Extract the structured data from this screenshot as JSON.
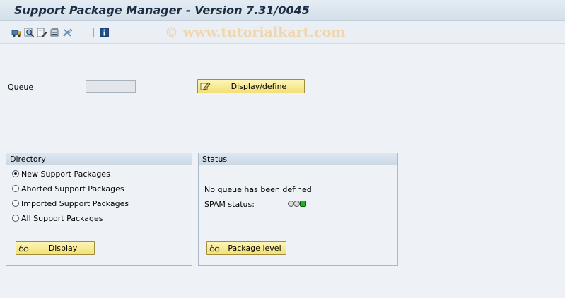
{
  "window": {
    "title": "Support Package Manager - Version 7.31/0045"
  },
  "watermark": "© www.tutorialkart.com",
  "toolbar": {
    "icons": [
      "truck-icon",
      "magnifier-icon",
      "edit-document-icon",
      "import-icon",
      "tools-icon",
      "info-icon"
    ]
  },
  "queue": {
    "label": "Queue",
    "value": "",
    "button_label": "Display/define"
  },
  "directory": {
    "title": "Directory",
    "options": [
      {
        "label": "New Support Packages",
        "selected": true
      },
      {
        "label": "Aborted Support Packages",
        "selected": false
      },
      {
        "label": "Imported Support Packages",
        "selected": false
      },
      {
        "label": "All Support Packages",
        "selected": false
      }
    ],
    "button_label": "Display"
  },
  "status": {
    "title": "Status",
    "message": "No queue has been defined",
    "spam_label": "SPAM status:",
    "spam_lights": [
      "grey",
      "grey",
      "green"
    ],
    "button_label": "Package level"
  },
  "colors": {
    "button_yellow": "#f8ea96",
    "light_green": "#18b81a"
  }
}
